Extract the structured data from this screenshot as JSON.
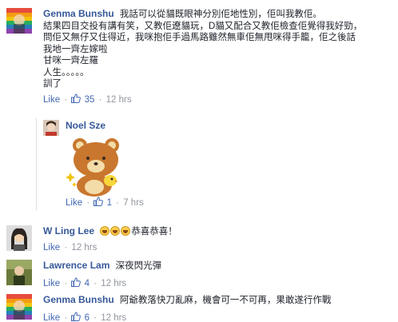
{
  "comments": [
    {
      "author": "Genma Bunshu",
      "lines": [
        "我話可以從貓既眼神分別佢地性別，佢叫我教佢。",
        "結果四目交投有講有笑，又教佢遼貓玩，D貓又配合又教佢檢查佢覺得我好勁，",
        "問佢又無仔又住得近，我咪抱佢手過馬路雖然無車佢無甩咪得手籠，佢之後話",
        "我地一齊左嫁啦",
        "甘咪一齊左羅",
        "人生。。。。。",
        "訓了"
      ],
      "like_label": "Like",
      "dot": "·",
      "like_count": "35",
      "time": "12 hrs"
    },
    {
      "author": "Noel Sze",
      "like_label": "Like",
      "dot": "·",
      "like_count": "1",
      "time": "7 hrs"
    },
    {
      "author": "W Ling Lee",
      "text": "恭喜恭喜！",
      "like_label": "Like",
      "time": "12 hrs"
    },
    {
      "author": "Lawrence Lam",
      "text": "深夜閃光彈",
      "like_label": "Like",
      "dot": "·",
      "like_count": "4",
      "time": "12 hrs"
    },
    {
      "author": "Genma Bunshu",
      "text": "阿爺教落快刀亂麻，機會可一不可再，果敢遂行作戰",
      "like_label": "Like",
      "dot": "·",
      "like_count": "6",
      "time": "12 hrs"
    }
  ],
  "colors": {
    "name": "#365899",
    "like": "#4267b2",
    "meta": "#90949c",
    "text": "#1d2129"
  },
  "icons": [
    "thumbs-up-icon",
    "laughing-emoji-icon",
    "bear-sticker"
  ]
}
